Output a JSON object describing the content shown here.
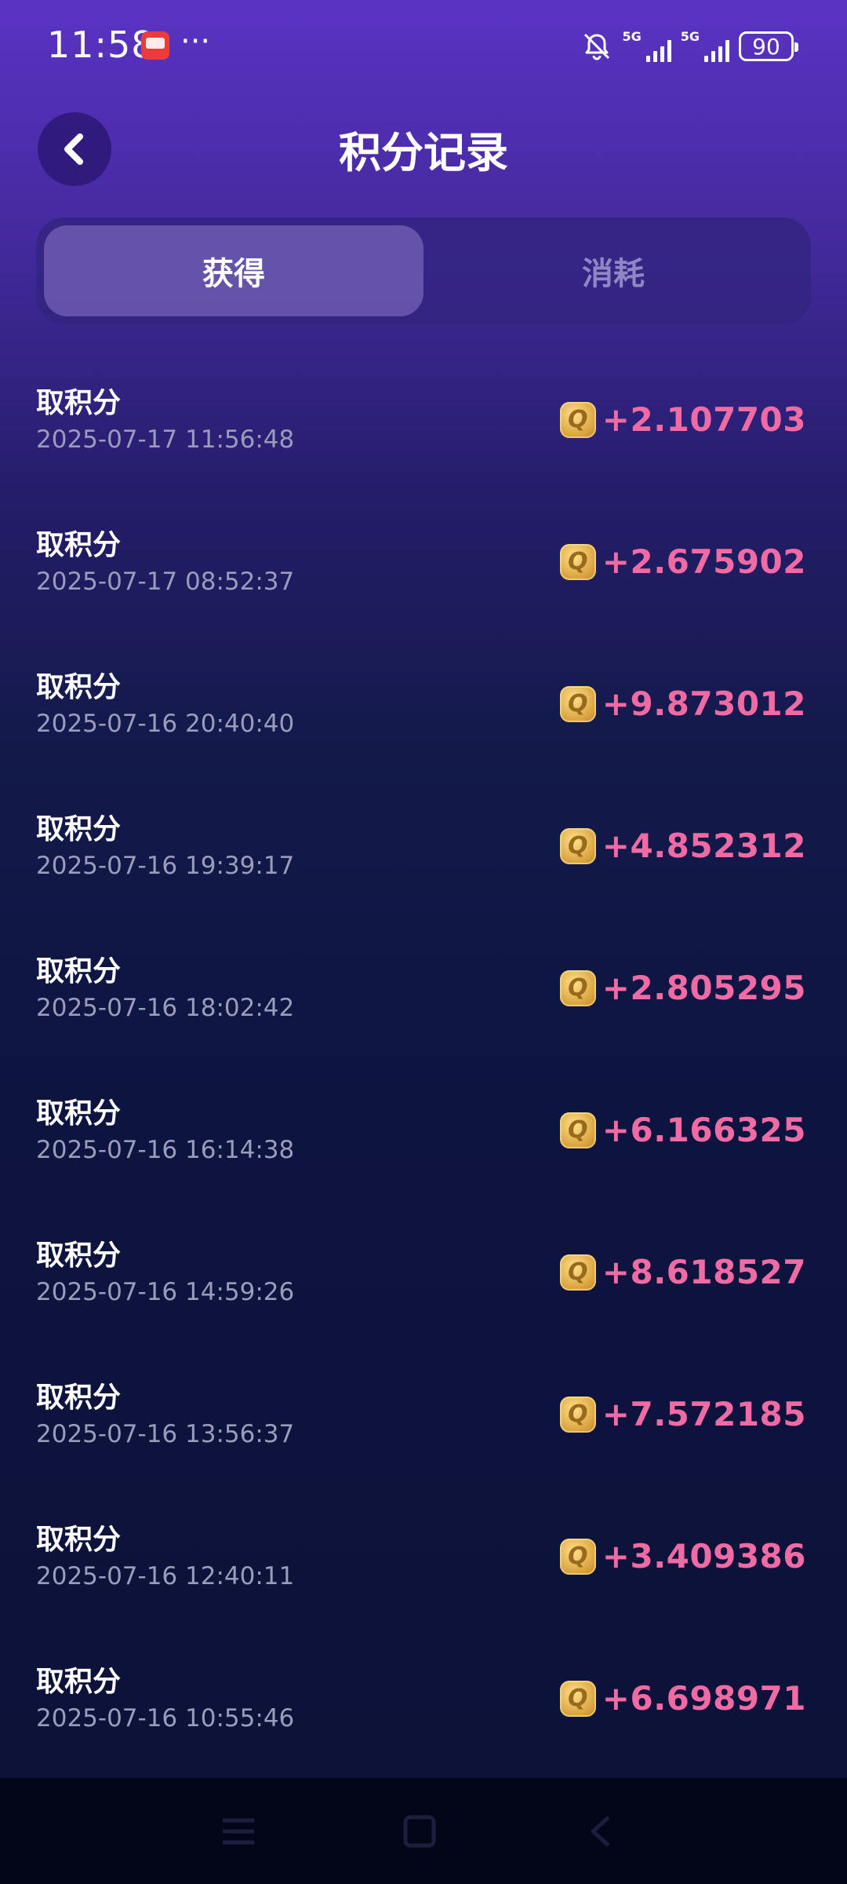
{
  "status_bar": {
    "time": "11:58",
    "dots": "···",
    "network_1": "5G",
    "network_2": "5G",
    "battery": "90"
  },
  "header": {
    "title": "积分记录"
  },
  "tabs": [
    {
      "label": "获得",
      "active": true
    },
    {
      "label": "消耗",
      "active": false
    }
  ],
  "records": [
    {
      "title": "取积分",
      "time": "2025-07-17 11:56:48",
      "amount": "+2.107703"
    },
    {
      "title": "取积分",
      "time": "2025-07-17 08:52:37",
      "amount": "+2.675902"
    },
    {
      "title": "取积分",
      "time": "2025-07-16 20:40:40",
      "amount": "+9.873012"
    },
    {
      "title": "取积分",
      "time": "2025-07-16 19:39:17",
      "amount": "+4.852312"
    },
    {
      "title": "取积分",
      "time": "2025-07-16 18:02:42",
      "amount": "+2.805295"
    },
    {
      "title": "取积分",
      "time": "2025-07-16 16:14:38",
      "amount": "+6.166325"
    },
    {
      "title": "取积分",
      "time": "2025-07-16 14:59:26",
      "amount": "+8.618527"
    },
    {
      "title": "取积分",
      "time": "2025-07-16 13:56:37",
      "amount": "+7.572185"
    },
    {
      "title": "取积分",
      "time": "2025-07-16 12:40:11",
      "amount": "+3.409386"
    },
    {
      "title": "取积分",
      "time": "2025-07-16 10:55:46",
      "amount": "+6.698971"
    }
  ],
  "icons": {
    "coin": "coin-q-icon",
    "coin_glyph": "Q"
  },
  "colors": {
    "amount": "#f06aa4",
    "bg_top": "#5a33c4",
    "bg_bottom": "#0c1238"
  }
}
